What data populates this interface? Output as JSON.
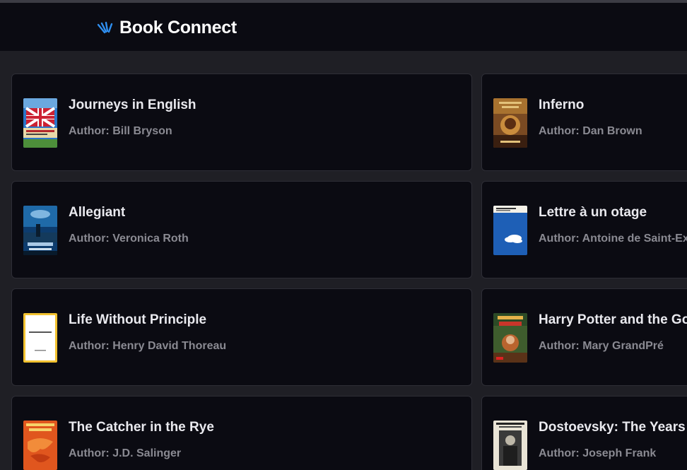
{
  "app": {
    "name": "Book Connect",
    "logo_icon": "book-connect-logo-icon",
    "accent": "#2f8ff0"
  },
  "books": [
    {
      "title": "Journeys in English",
      "author": "Author: Bill Bryson"
    },
    {
      "title": "Inferno",
      "author": "Author: Dan Brown"
    },
    {
      "title": "Allegiant",
      "author": "Author: Veronica Roth"
    },
    {
      "title": "Lettre à un otage",
      "author": "Author: Antoine de Saint-Exupéry"
    },
    {
      "title": "Life Without Principle",
      "author": "Author: Henry David Thoreau"
    },
    {
      "title": "Harry Potter and the Goblet of Fire",
      "author": "Author: Mary GrandPré"
    },
    {
      "title": "The Catcher in the Rye",
      "author": "Author: J.D. Salinger"
    },
    {
      "title": "Dostoevsky: The Years of Ordeal",
      "author": "Author: Joseph Frank"
    }
  ]
}
